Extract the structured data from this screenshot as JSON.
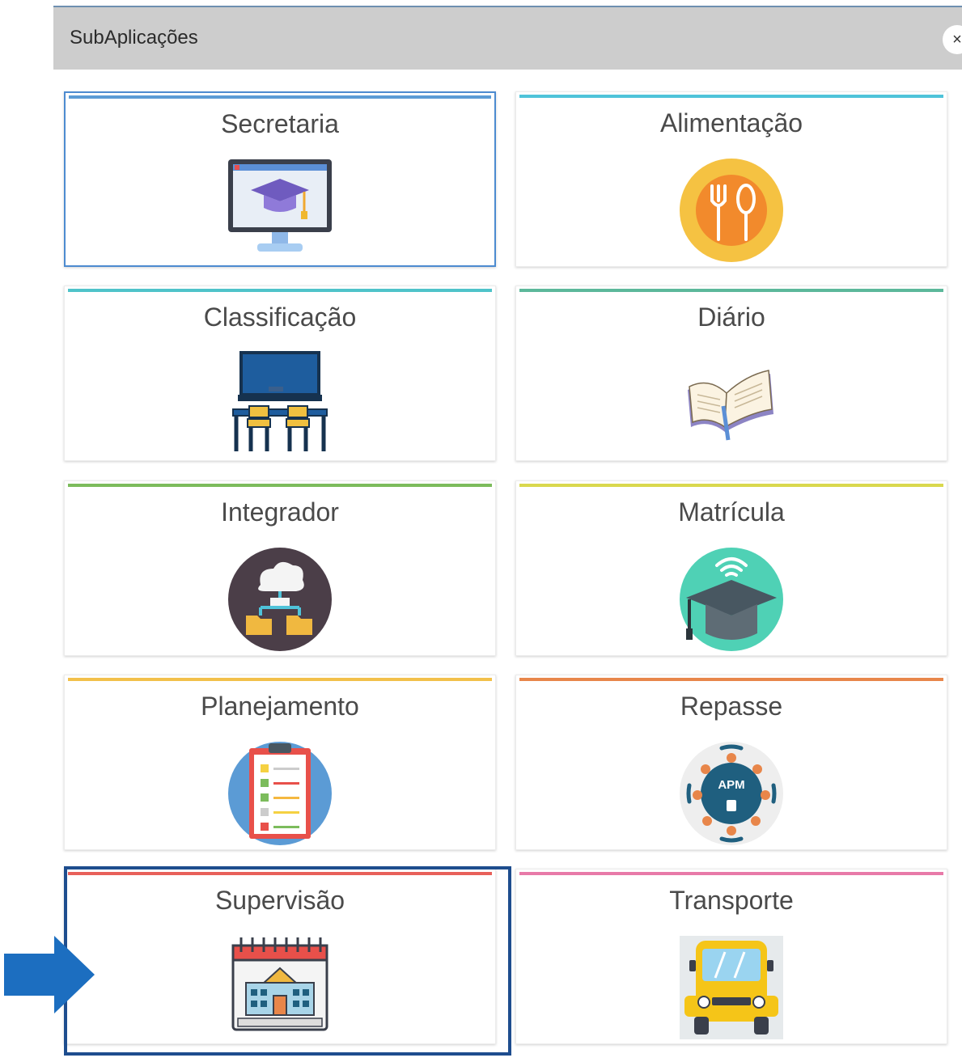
{
  "header": {
    "title": "SubAplicações",
    "close_label": "×"
  },
  "apps": [
    {
      "label": "Secretaria",
      "accent": "#5b9bd5",
      "icon": "computer-graduation-icon"
    },
    {
      "label": "Alimentação",
      "accent": "#4fc3d9",
      "icon": "fork-spoon-icon"
    },
    {
      "label": "Classificação",
      "accent": "#4fc3c9",
      "icon": "classroom-icon"
    },
    {
      "label": "Diário",
      "accent": "#5cb89a",
      "icon": "open-book-icon"
    },
    {
      "label": "Integrador",
      "accent": "#7cbc5c",
      "icon": "cloud-network-icon"
    },
    {
      "label": "Matrícula",
      "accent": "#d9d84e",
      "icon": "graduation-cap-wifi-icon"
    },
    {
      "label": "Planejamento",
      "accent": "#f2c04a",
      "icon": "clipboard-checklist-icon"
    },
    {
      "label": "Repasse",
      "accent": "#e8864a",
      "icon": "apm-network-icon"
    },
    {
      "label": "Supervisão",
      "accent": "#e8605a",
      "icon": "calendar-school-icon"
    },
    {
      "label": "Transporte",
      "accent": "#e87aa8",
      "icon": "school-bus-icon"
    }
  ],
  "colors": {
    "header_bg": "#cdcdcd",
    "highlight": "#1e4d8e",
    "arrow": "#1c6ec0"
  },
  "apm_badge": "APM"
}
